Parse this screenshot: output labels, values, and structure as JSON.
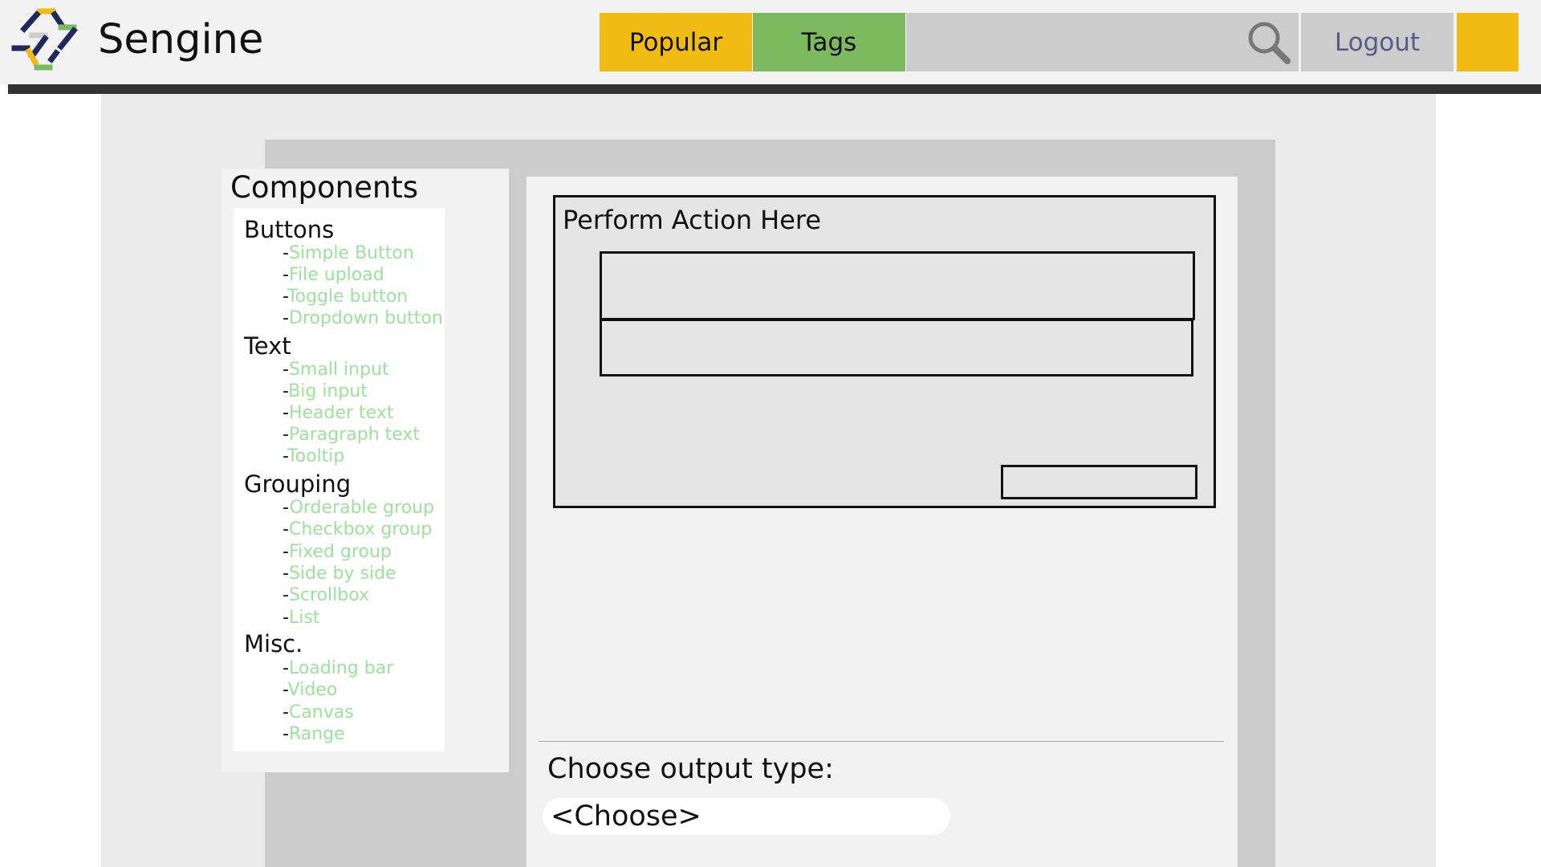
{
  "header": {
    "brand": "Sengine",
    "nav": {
      "popular": "Popular",
      "tags": "Tags"
    },
    "logout": "Logout",
    "colors": {
      "popular": "#f0bc14",
      "tags": "#7db95e",
      "user": "#f0bc14",
      "bar": "#333333"
    }
  },
  "sidebar": {
    "title": "Components",
    "groups": [
      {
        "title": "Buttons",
        "items": [
          "Simple Button",
          "File upload",
          "Toggle button",
          "Dropdown button"
        ]
      },
      {
        "title": "Text",
        "items": [
          "Small input",
          "Big input",
          "Header text",
          "Paragraph text",
          "Tooltip"
        ]
      },
      {
        "title": "Grouping",
        "items": [
          "Orderable group",
          "Checkbox group",
          "Fixed group",
          "Side by side",
          "Scrollbox",
          "List"
        ]
      },
      {
        "title": "Misc.",
        "items": [
          "Loading bar",
          "Video",
          "Canvas",
          "Range"
        ]
      }
    ],
    "link_color": "#9be29b"
  },
  "workspace": {
    "action_title": "Perform Action Here",
    "output_label": "Choose output type:",
    "output_value": "<Choose>"
  },
  "icons": {
    "logo": "sengine-logo-icon",
    "search": "search-icon"
  }
}
